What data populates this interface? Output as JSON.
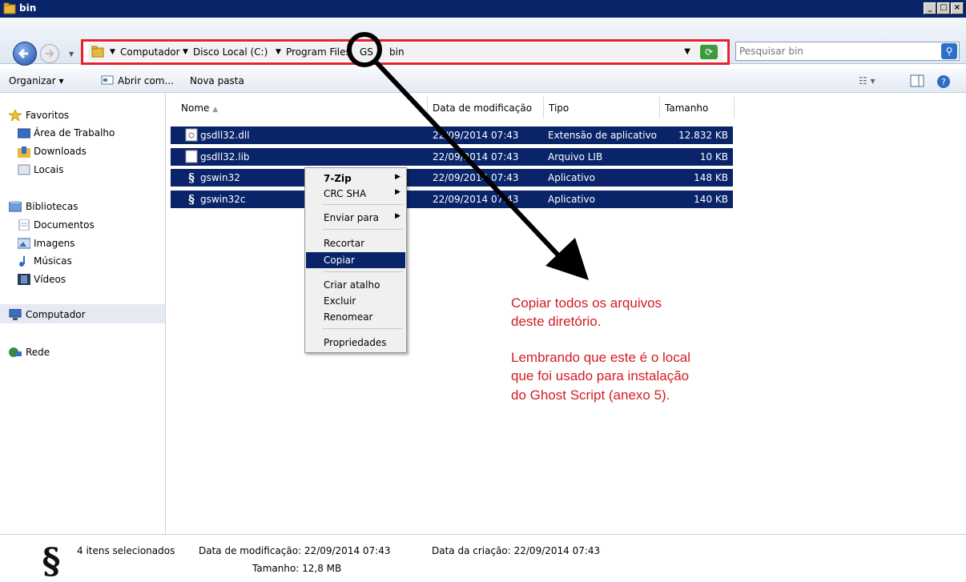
{
  "window": {
    "title": "bin"
  },
  "address": {
    "crumbs": [
      "Computador",
      "Disco Local (C:)",
      "Program Files",
      "GS",
      "bin"
    ],
    "search_placeholder": "Pesquisar bin"
  },
  "toolbar": {
    "organize": "Organizar",
    "open_with": "Abrir com...",
    "new_folder": "Nova pasta"
  },
  "nav": {
    "favorites": "Favoritos",
    "fav_items": [
      "Área de Trabalho",
      "Downloads",
      "Locais"
    ],
    "libraries": "Bibliotecas",
    "lib_items": [
      "Documentos",
      "Imagens",
      "Músicas",
      "Vídeos"
    ],
    "computer": "Computador",
    "network": "Rede"
  },
  "columns": [
    "Nome",
    "Data de modificação",
    "Tipo",
    "Tamanho"
  ],
  "files": [
    {
      "name": "gsdll32.dll",
      "date": "22/09/2014 07:43",
      "type": "Extensão de aplicativo",
      "size": "12.832 KB",
      "icon": "dll-file-icon"
    },
    {
      "name": "gsdll32.lib",
      "date": "22/09/2014 07:43",
      "type": "Arquivo LIB",
      "size": "10 KB",
      "icon": "lib-file-icon"
    },
    {
      "name": "gswin32",
      "date": "22/09/2014 07:43",
      "type": "Aplicativo",
      "size": "148 KB",
      "icon": "ghostscript-app-icon"
    },
    {
      "name": "gswin32c",
      "date": "22/09/2014 07:43",
      "type": "Aplicativo",
      "size": "140 KB",
      "icon": "ghostscript-app-icon"
    }
  ],
  "context_menu": {
    "items": [
      "7-Zip",
      "CRC SHA",
      "Enviar para",
      "Recortar",
      "Copiar",
      "Criar atalho",
      "Excluir",
      "Renomear",
      "Propriedades"
    ],
    "highlighted": "Copiar"
  },
  "annotation": {
    "lines": [
      "Copiar todos os arquivos",
      "deste diretório.",
      "Lembrando que este é o local",
      "que foi usado para instalação",
      "do Ghost Script (anexo 5)."
    ],
    "color": "#d31c23"
  },
  "status": {
    "selected": "4 itens selecionados",
    "modified": "Data de modificação: 22/09/2014 07:43",
    "created": "Data da criação: 22/09/2014 07:43",
    "size": "Tamanho: 12,8 MB"
  },
  "colors": {
    "selection": "#0a246a",
    "highlight_box": "#e8202c"
  }
}
